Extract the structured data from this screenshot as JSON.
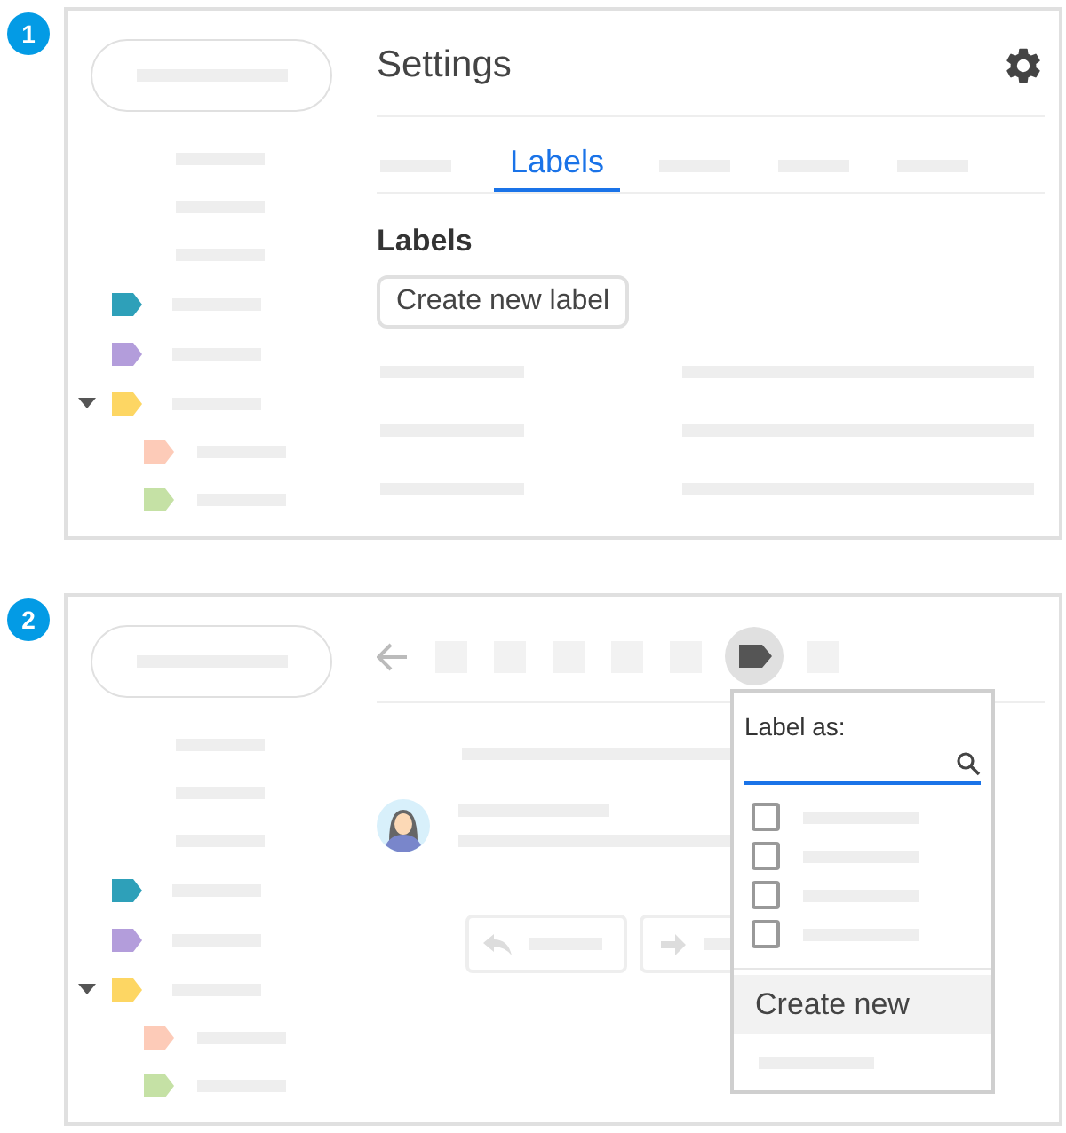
{
  "steps": [
    {
      "number": "1",
      "kind": "settings",
      "sidebar": {
        "labels": [
          {
            "color": "#2ea0b9"
          },
          {
            "color": "#b39ddb"
          },
          {
            "color": "#fdd663",
            "expanded": true,
            "children": [
              {
                "color": "#fdcbb8"
              },
              {
                "color": "#c5e1a5"
              }
            ]
          }
        ]
      },
      "title": "Settings",
      "tab": {
        "label": "Labels",
        "selected": true
      },
      "section_title": "Labels",
      "button": "Create new label"
    },
    {
      "number": "2",
      "kind": "message",
      "sidebar": {
        "labels": [
          {
            "color": "#2ea0b9"
          },
          {
            "color": "#b39ddb"
          },
          {
            "color": "#fdd663",
            "expanded": true,
            "children": [
              {
                "color": "#fdcbb8"
              },
              {
                "color": "#c5e1a5"
              }
            ]
          }
        ]
      },
      "menu": {
        "title": "Label as:",
        "checkboxes": [
          {
            "checked": false
          },
          {
            "checked": false
          },
          {
            "checked": false
          },
          {
            "checked": false
          }
        ],
        "create_item": {
          "label": "Create new",
          "selected": true
        }
      }
    }
  ]
}
